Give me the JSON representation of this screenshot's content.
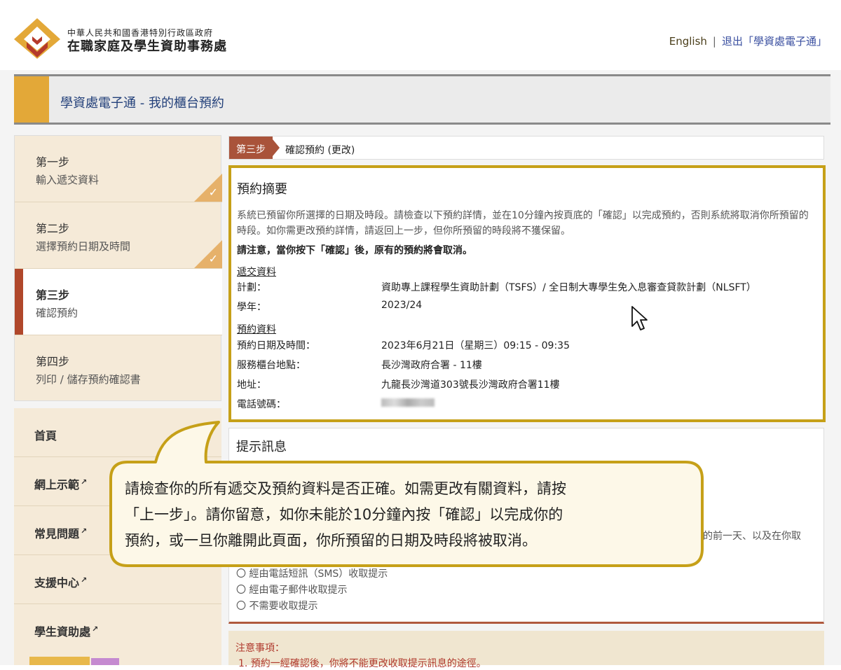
{
  "header": {
    "org_sub": "中華人民共和國香港特別行政區政府",
    "org_main": "在職家庭及學生資助事務處",
    "lang_link": "English",
    "separator": "|",
    "logout_link": "退出「學資處電子通」"
  },
  "page_title": "學資處電子通 - 我的櫃台預約",
  "steps": [
    {
      "num": "第一步",
      "desc": "輸入遞交資料",
      "done": true
    },
    {
      "num": "第二步",
      "desc": "選擇預約日期及時間",
      "done": true
    },
    {
      "num": "第三步",
      "desc": "確認預約",
      "active": true
    },
    {
      "num": "第四步",
      "desc": "列印 / 儲存預約確認書"
    }
  ],
  "menu": [
    {
      "label": "首頁",
      "external": false
    },
    {
      "label": "網上示範",
      "external": true
    },
    {
      "label": "常見問題",
      "external": true
    },
    {
      "label": "支援中心",
      "external": true
    },
    {
      "label": "學生資助處",
      "external": true
    }
  ],
  "step_header": {
    "tag": "第三步",
    "title": "確認預約 (更改)"
  },
  "summary": {
    "heading": "預約摘要",
    "intro": "系統已預留你所選擇的日期及時段。請檢查以下預約詳情，並在10分鐘內按頁底的「確認」以完成預約，否則系統將取消你所預留的時段。如你需更改預約詳情，請返回上一步，但你所預留的時段將不獲保留。",
    "warning": "請注意，當你按下「確認」後，原有的預約將會取消。",
    "submission_section": "遞交資料",
    "scheme_label": "計劃：",
    "scheme_value": "資助專上課程學生資助計劃（TSFS）/ 全日制大專學生免入息審查貸款計劃（NLSFT）",
    "year_label": "學年：",
    "year_value": "2023/24",
    "booking_section": "預約資料",
    "datetime_label": "預約日期及時間：",
    "datetime_value": "2023年6月21日（星期三）09:15 - 09:35",
    "counter_label": "服務櫃台地點：",
    "counter_value": "長沙灣政府合署 - 11樓",
    "address_label": "地址：",
    "address_value": "九龍長沙灣道303號長沙灣政府合署11樓",
    "phone_label": "電話號碼："
  },
  "reminder": {
    "heading": "提示訊息",
    "partial_text": "的前一天、以及在你取",
    "options": [
      "〇 經由電話短訊（SMS）收取提示",
      "〇 經由電子郵件收取提示",
      "〇 不需要收取提示"
    ]
  },
  "caution": {
    "title": "注意事項：",
    "item1": "1. 預約一經確認後，你將不能更改收取提示訊息的途徑。"
  },
  "callout": {
    "line1": "請檢查你的所有遞交及預約資料是否正確。如需更改有關資料，請按",
    "line2": "「上一步」。請你留意，如你未能於10分鐘內按「確認」以完成你的",
    "line3": "預約，或一旦你離開此頁面，你所預留的日期及時段將被取消。"
  },
  "colors": {
    "accent_gold": "#c6a018",
    "step_tag": "#a9533a",
    "title_blue": "#23407a",
    "callout_fill": "#fdf8e8"
  }
}
